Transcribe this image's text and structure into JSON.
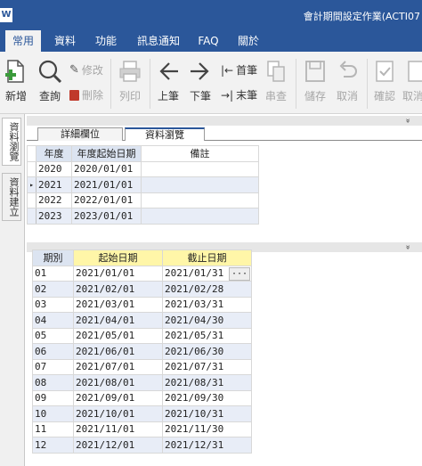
{
  "window": {
    "logo": "W",
    "title": "會計期間設定作業(ACTI07"
  },
  "menu": [
    "常用",
    "資料",
    "功能",
    "訊息通知",
    "FAQ",
    "關於"
  ],
  "toolbar": {
    "new": "新增",
    "query": "查詢",
    "edit": "修改",
    "delete": "刪除",
    "print": "列印",
    "prev": "上筆",
    "next": "下筆",
    "first": "首筆",
    "last": "末筆",
    "stringquery": "串查",
    "save": "儲存",
    "cancel": "取消",
    "confirm": "確認",
    "cancel2": "取消"
  },
  "side_tabs": [
    "資料瀏覽",
    "資料建立"
  ],
  "detail_tabs": [
    "詳細欄位",
    "資料瀏覽"
  ],
  "collapse_glyph": "»",
  "grid1": {
    "headers": [
      "年度",
      "年度起始日期",
      "備註"
    ],
    "rows": [
      {
        "year": "2020",
        "start": "2020/01/01",
        "note": ""
      },
      {
        "year": "2021",
        "start": "2021/01/01",
        "note": ""
      },
      {
        "year": "2022",
        "start": "2022/01/01",
        "note": ""
      },
      {
        "year": "2023",
        "start": "2023/01/01",
        "note": ""
      }
    ],
    "row_indicator": "▸"
  },
  "grid2": {
    "headers": [
      "期別",
      "起始日期",
      "截止日期"
    ],
    "ellipsis": "···",
    "rows": [
      {
        "period": "01",
        "start": "2021/01/01",
        "end": "2021/01/31"
      },
      {
        "period": "02",
        "start": "2021/02/01",
        "end": "2021/02/28"
      },
      {
        "period": "03",
        "start": "2021/03/01",
        "end": "2021/03/31"
      },
      {
        "period": "04",
        "start": "2021/04/01",
        "end": "2021/04/30"
      },
      {
        "period": "05",
        "start": "2021/05/01",
        "end": "2021/05/31"
      },
      {
        "period": "06",
        "start": "2021/06/01",
        "end": "2021/06/30"
      },
      {
        "period": "07",
        "start": "2021/07/01",
        "end": "2021/07/31"
      },
      {
        "period": "08",
        "start": "2021/08/01",
        "end": "2021/08/31"
      },
      {
        "period": "09",
        "start": "2021/09/01",
        "end": "2021/09/30"
      },
      {
        "period": "10",
        "start": "2021/10/01",
        "end": "2021/10/31"
      },
      {
        "period": "11",
        "start": "2021/11/01",
        "end": "2021/11/30"
      },
      {
        "period": "12",
        "start": "2021/12/01",
        "end": "2021/12/31"
      }
    ]
  }
}
